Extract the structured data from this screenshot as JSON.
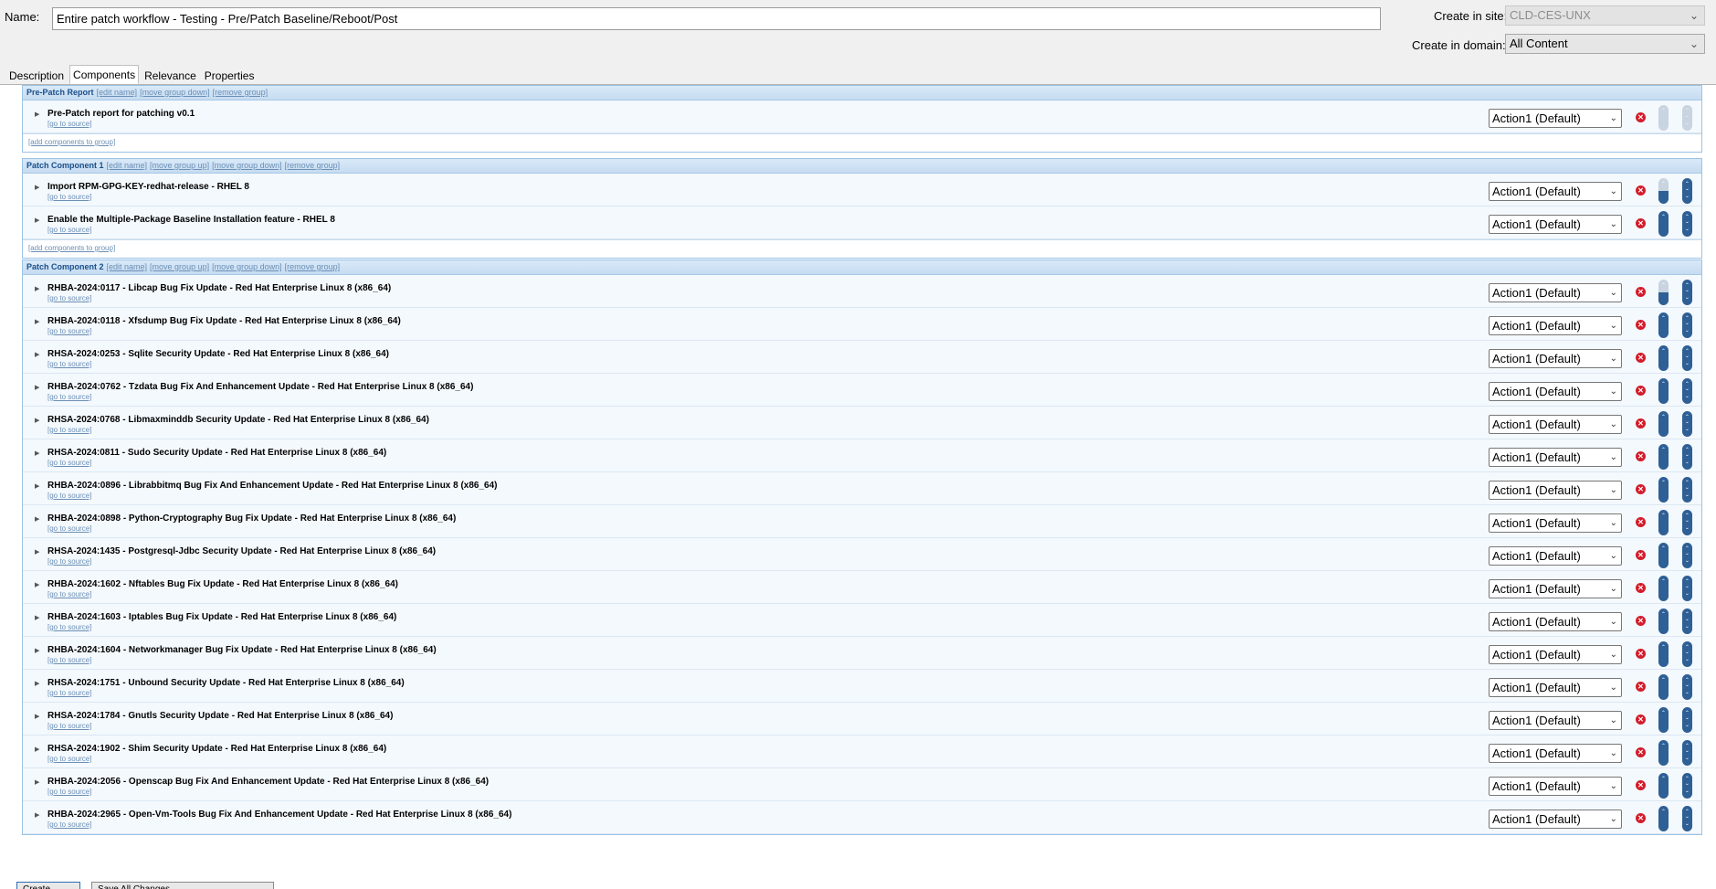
{
  "header": {
    "name_label": "Name:",
    "name_value": "Entire patch workflow - Testing - Pre/Patch Baseline/Reboot/Post",
    "site_label": "Create in site:",
    "site_value": "CLD-CES-UNX",
    "domain_label": "Create in domain:",
    "domain_value": "All Content"
  },
  "tabs": [
    {
      "label": "Description"
    },
    {
      "label": "Components"
    },
    {
      "label": "Relevance"
    },
    {
      "label": "Properties"
    }
  ],
  "group_links": {
    "edit_name": "[edit name]",
    "move_up": "[move group up]",
    "move_down": "[move group down]",
    "remove": "[remove group]",
    "add_components": "[add components to group]"
  },
  "row_common": {
    "go_to_source": "[go to source]",
    "action_value": "Action1 (Default)"
  },
  "groups": [
    {
      "title": "Pre-Patch Report",
      "components": [
        {
          "title": "Pre-Patch report for patching v0.1"
        }
      ]
    },
    {
      "title": "Patch Component 1",
      "components": [
        {
          "title": "Import RPM-GPG-KEY-redhat-release - RHEL 8"
        },
        {
          "title": "Enable the Multiple-Package Baseline Installation feature - RHEL 8"
        }
      ]
    },
    {
      "title": "Patch Component 2",
      "components": [
        {
          "title": "RHBA-2024:0117 - Libcap Bug Fix Update - Red Hat Enterprise Linux 8 (x86_64)"
        },
        {
          "title": "RHBA-2024:0118 - Xfsdump Bug Fix Update - Red Hat Enterprise Linux 8 (x86_64)"
        },
        {
          "title": "RHSA-2024:0253 - Sqlite Security Update - Red Hat Enterprise Linux 8 (x86_64)"
        },
        {
          "title": "RHBA-2024:0762 - Tzdata Bug Fix And Enhancement Update - Red Hat Enterprise Linux 8 (x86_64)"
        },
        {
          "title": "RHSA-2024:0768 - Libmaxminddb Security Update - Red Hat Enterprise Linux 8 (x86_64)"
        },
        {
          "title": "RHSA-2024:0811 - Sudo Security Update - Red Hat Enterprise Linux 8 (x86_64)"
        },
        {
          "title": "RHBA-2024:0896 - Librabbitmq Bug Fix And Enhancement Update - Red Hat Enterprise Linux 8 (x86_64)"
        },
        {
          "title": "RHBA-2024:0898 - Python-Cryptography Bug Fix Update - Red Hat Enterprise Linux 8 (x86_64)"
        },
        {
          "title": "RHSA-2024:1435 - Postgresql-Jdbc Security Update - Red Hat Enterprise Linux 8 (x86_64)"
        },
        {
          "title": "RHBA-2024:1602 - Nftables Bug Fix Update - Red Hat Enterprise Linux 8 (x86_64)"
        },
        {
          "title": "RHBA-2024:1603 - Iptables Bug Fix Update - Red Hat Enterprise Linux 8 (x86_64)"
        },
        {
          "title": "RHBA-2024:1604 - Networkmanager Bug Fix Update - Red Hat Enterprise Linux 8 (x86_64)"
        },
        {
          "title": "RHSA-2024:1751 - Unbound Security Update - Red Hat Enterprise Linux 8 (x86_64)"
        },
        {
          "title": "RHSA-2024:1784 - Gnutls Security Update - Red Hat Enterprise Linux 8 (x86_64)"
        },
        {
          "title": "RHSA-2024:1902 - Shim Security Update - Red Hat Enterprise Linux 8 (x86_64)"
        },
        {
          "title": "RHBA-2024:2056 - Openscap Bug Fix And Enhancement Update - Red Hat Enterprise Linux 8 (x86_64)"
        },
        {
          "title": "RHBA-2024:2965 - Open-Vm-Tools Bug Fix And Enhancement Update - Red Hat Enterprise Linux 8 (x86_64)"
        }
      ]
    }
  ],
  "footer": {
    "primary_label": "Create",
    "secondary_label": "Save All Changes"
  }
}
